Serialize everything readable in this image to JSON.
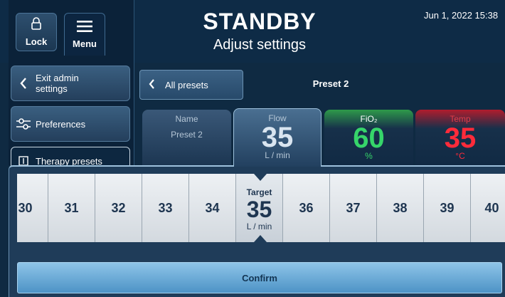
{
  "header": {
    "lock_label": "Lock",
    "menu_label": "Menu",
    "status": "STANDBY",
    "subtitle": "Adjust settings",
    "datetime": "Jun 1, 2022 15:38"
  },
  "sidebar": {
    "exit_label": "Exit admin settings",
    "preferences_label": "Preferences",
    "presets_label": "Therapy presets"
  },
  "presets_bar": {
    "back_label": "All presets",
    "current_preset": "Preset 2"
  },
  "tabs": {
    "name": {
      "label": "Name",
      "value": "Preset 2"
    },
    "flow": {
      "label": "Flow",
      "value": "35",
      "unit": "L / min"
    },
    "fio2": {
      "label": "FiO₂",
      "value": "60",
      "unit": "%"
    },
    "temp": {
      "label": "Temp",
      "value": "35",
      "unit": "°C"
    }
  },
  "picker": {
    "values": [
      "30",
      "31",
      "32",
      "33",
      "34",
      "35",
      "36",
      "37",
      "38",
      "39",
      "40"
    ],
    "target_label": "Target",
    "target_value": "35",
    "target_unit": "L / min"
  },
  "confirm_label": "Confirm",
  "colors": {
    "background": "#0f2a42",
    "fio2_accent": "#36d56a",
    "temp_accent": "#ff2b3a",
    "confirm": "#6aabd8"
  },
  "icons": [
    "lock-icon",
    "menu-icon",
    "chevron-left-icon",
    "sliders-icon",
    "presets-icon"
  ]
}
